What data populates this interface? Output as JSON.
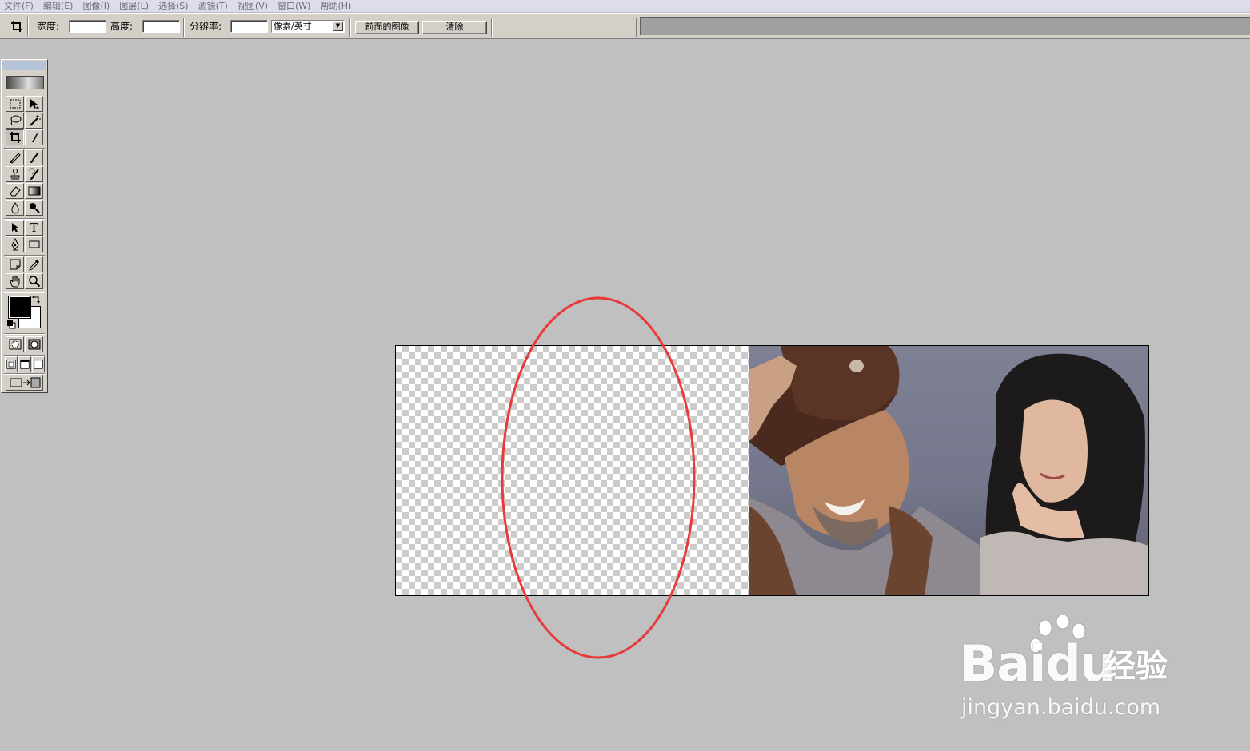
{
  "menu": [
    "文件(F)",
    "编辑(E)",
    "图像(I)",
    "图层(L)",
    "选择(S)",
    "滤镜(T)",
    "视图(V)",
    "窗口(W)",
    "帮助(H)"
  ],
  "options_bar": {
    "width_label": "宽度:",
    "width_value": "",
    "height_label": "高度:",
    "height_value": "",
    "resolution_label": "分辨率:",
    "resolution_value": "",
    "unit_select": "像素/英寸",
    "front_image_button": "前面的图像",
    "clear_button": "清除"
  },
  "toolbox": {
    "tools": [
      "rectangular-marquee-icon",
      "move-icon",
      "lasso-icon",
      "magic-wand-icon",
      "crop-icon",
      "slice-icon",
      "healing-brush-icon",
      "brush-icon",
      "clone-stamp-icon",
      "history-brush-icon",
      "eraser-icon",
      "gradient-icon",
      "blur-icon",
      "dodge-icon",
      "path-select-icon",
      "type-icon",
      "pen-icon",
      "rectangle-shape-icon",
      "notes-icon",
      "eyedropper-icon",
      "hand-icon",
      "zoom-icon"
    ],
    "text_tool_glyph": "T",
    "foreground_color": "#000000",
    "background_color": "#ffffff"
  },
  "annotation": {
    "color": "#e83a3a"
  },
  "watermark": {
    "brand_a": "Bai",
    "brand_b": "du",
    "chinese": "经验",
    "url": "jingyan.baidu.com"
  }
}
